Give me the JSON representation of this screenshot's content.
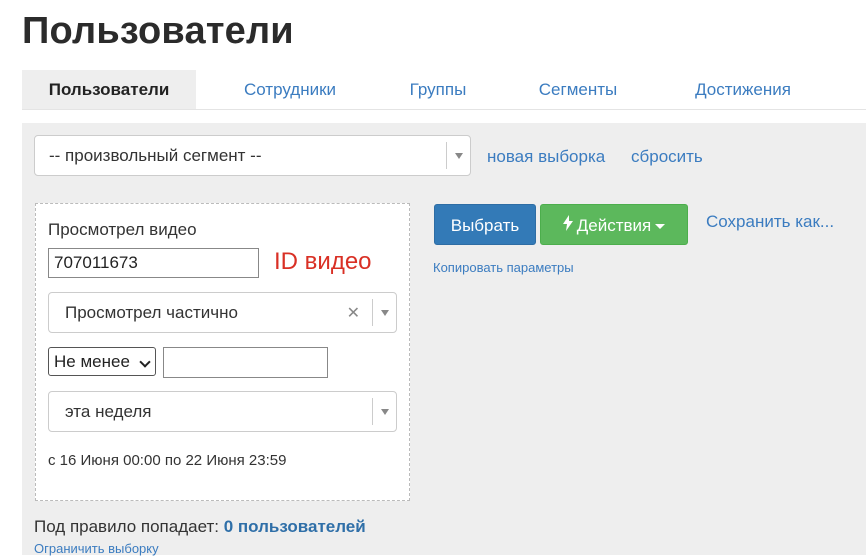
{
  "page": {
    "title": "Пользователи"
  },
  "tabs": [
    {
      "label": "Пользователи",
      "active": true
    },
    {
      "label": "Сотрудники",
      "active": false
    },
    {
      "label": "Группы",
      "active": false
    },
    {
      "label": "Сегменты",
      "active": false
    },
    {
      "label": "Достижения",
      "active": false
    }
  ],
  "segment": {
    "selected": "-- произвольный сегмент --",
    "new_selection": "новая выборка",
    "reset": "сбросить"
  },
  "rule": {
    "label": "Просмотрел видео",
    "video_id": "707011673",
    "video_id_hint": "ID видео",
    "watch_type": "Просмотрел частично",
    "comparison": "Не менее",
    "amount": "",
    "period": "эта неделя",
    "date_range": "с 16 Июня 00:00 по 22 Июня 23:59"
  },
  "actions": {
    "select": "Выбрать",
    "actions": "Действия",
    "save_as": "Сохранить как...",
    "copy_params": "Копировать параметры"
  },
  "summary": {
    "prefix": "Под правило попадает:",
    "count": "0 пользователей",
    "limit": "Ограничить выборку"
  },
  "colors": {
    "primary": "#337ab7",
    "success": "#5cb85c",
    "link": "#3b7cc0",
    "hint": "#d93025",
    "panel_bg": "#eeeeee"
  }
}
